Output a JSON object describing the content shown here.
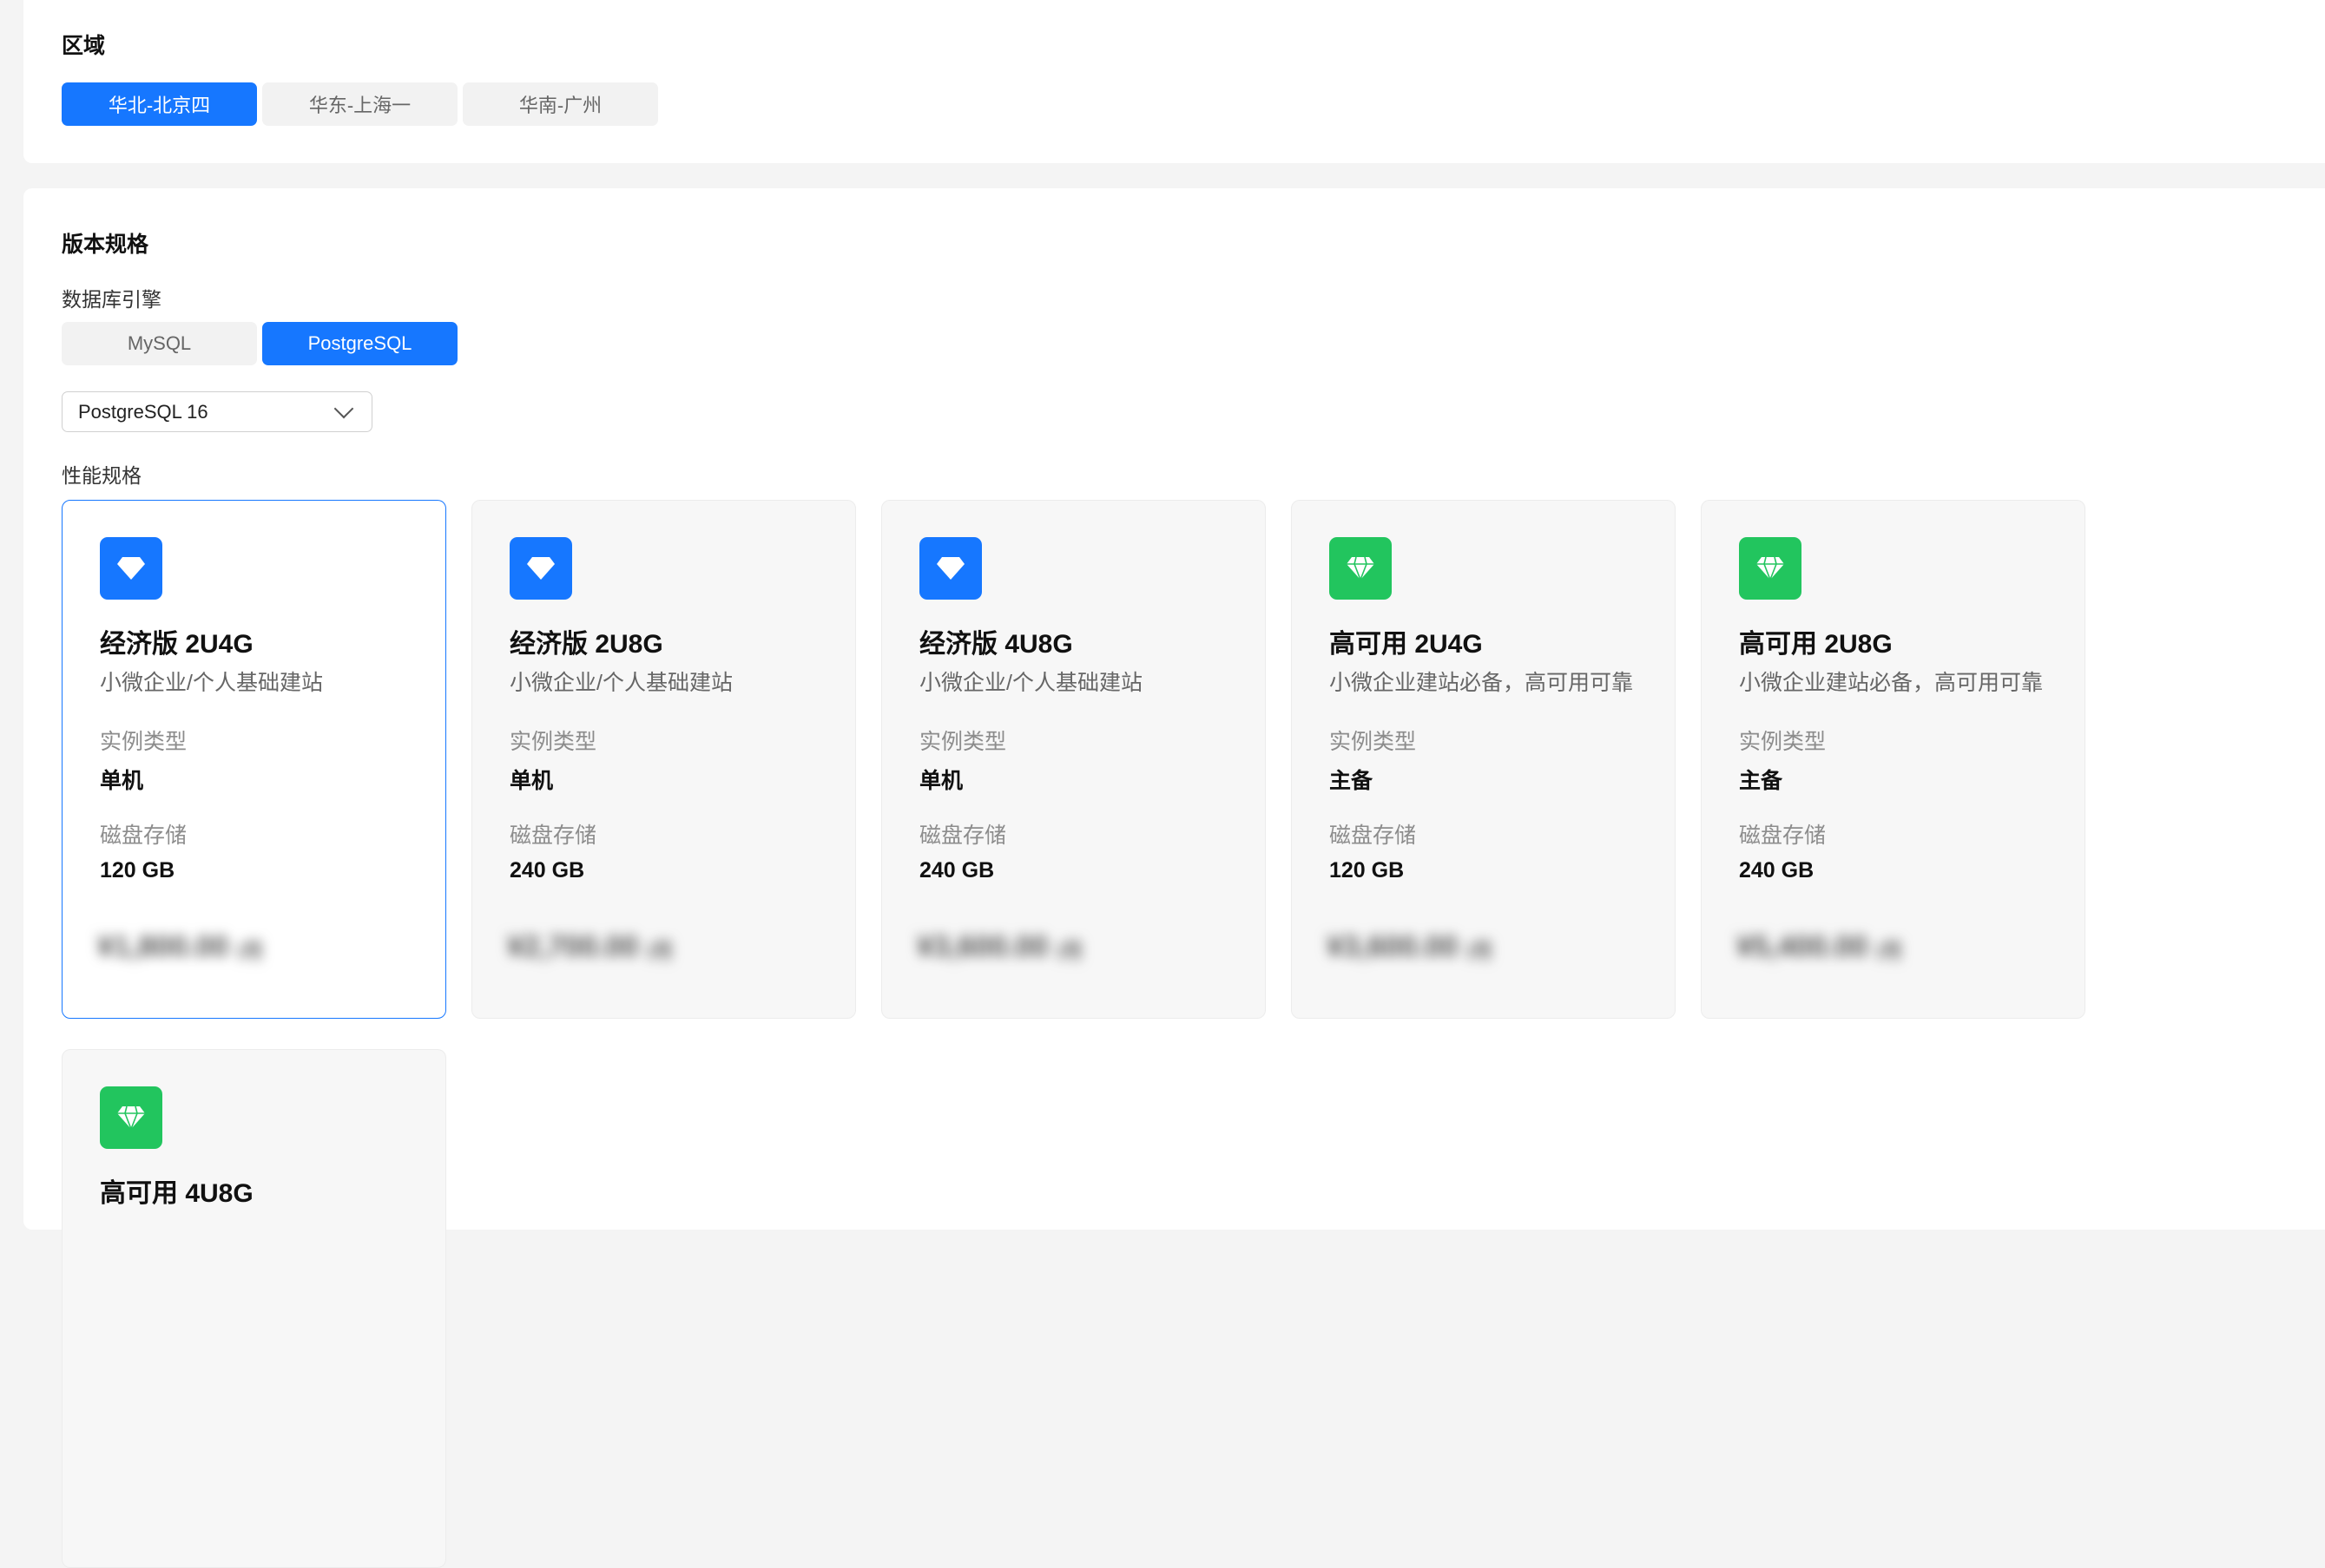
{
  "region": {
    "title": "区域",
    "options": [
      {
        "label": "华北-北京四",
        "active": true
      },
      {
        "label": "华东-上海一",
        "active": false
      },
      {
        "label": "华南-广州",
        "active": false
      }
    ]
  },
  "spec": {
    "title": "版本规格",
    "engine_label": "数据库引擎",
    "engines": [
      {
        "label": "MySQL",
        "active": false
      },
      {
        "label": "PostgreSQL",
        "active": true
      }
    ],
    "version_select": {
      "value": "PostgreSQL 16",
      "icon": "chevron-down-icon"
    },
    "perf_label": "性能规格",
    "cards": [
      {
        "title": "经济版 2U4G",
        "desc": "小微企业/个人基础建站",
        "type_label": "实例类型",
        "type_value": "单机",
        "disk_label": "磁盘存储",
        "disk_value": "120 GB",
        "price": "¥1,800.00",
        "price_unit": "/月",
        "icon": "diamond-icon",
        "icon_color": "#1677ff",
        "selected": true
      },
      {
        "title": "经济版 2U8G",
        "desc": "小微企业/个人基础建站",
        "type_label": "实例类型",
        "type_value": "单机",
        "disk_label": "磁盘存储",
        "disk_value": "240 GB",
        "price": "¥2,700.00",
        "price_unit": "/月",
        "icon": "diamond-icon",
        "icon_color": "#1677ff",
        "selected": false
      },
      {
        "title": "经济版 4U8G",
        "desc": "小微企业/个人基础建站",
        "type_label": "实例类型",
        "type_value": "单机",
        "disk_label": "磁盘存储",
        "disk_value": "240 GB",
        "price": "¥3,600.00",
        "price_unit": "/月",
        "icon": "diamond-icon",
        "icon_color": "#1677ff",
        "selected": false
      },
      {
        "title": "高可用 2U4G",
        "desc": "小微企业建站必备，高可用可靠",
        "type_label": "实例类型",
        "type_value": "主备",
        "disk_label": "磁盘存储",
        "disk_value": "120 GB",
        "price": "¥3,600.00",
        "price_unit": "/月",
        "icon": "gem-icon",
        "icon_color": "#22c55e",
        "selected": false
      },
      {
        "title": "高可用 2U8G",
        "desc": "小微企业建站必备，高可用可靠",
        "type_label": "实例类型",
        "type_value": "主备",
        "disk_label": "磁盘存储",
        "disk_value": "240 GB",
        "price": "¥5,400.00",
        "price_unit": "/月",
        "icon": "gem-icon",
        "icon_color": "#22c55e",
        "selected": false
      },
      {
        "title": "高可用 4U8G",
        "desc": "",
        "type_label": "",
        "type_value": "",
        "disk_label": "",
        "disk_value": "",
        "price": "",
        "price_unit": "",
        "icon": "gem-icon",
        "icon_color": "#22c55e",
        "selected": false
      }
    ]
  }
}
